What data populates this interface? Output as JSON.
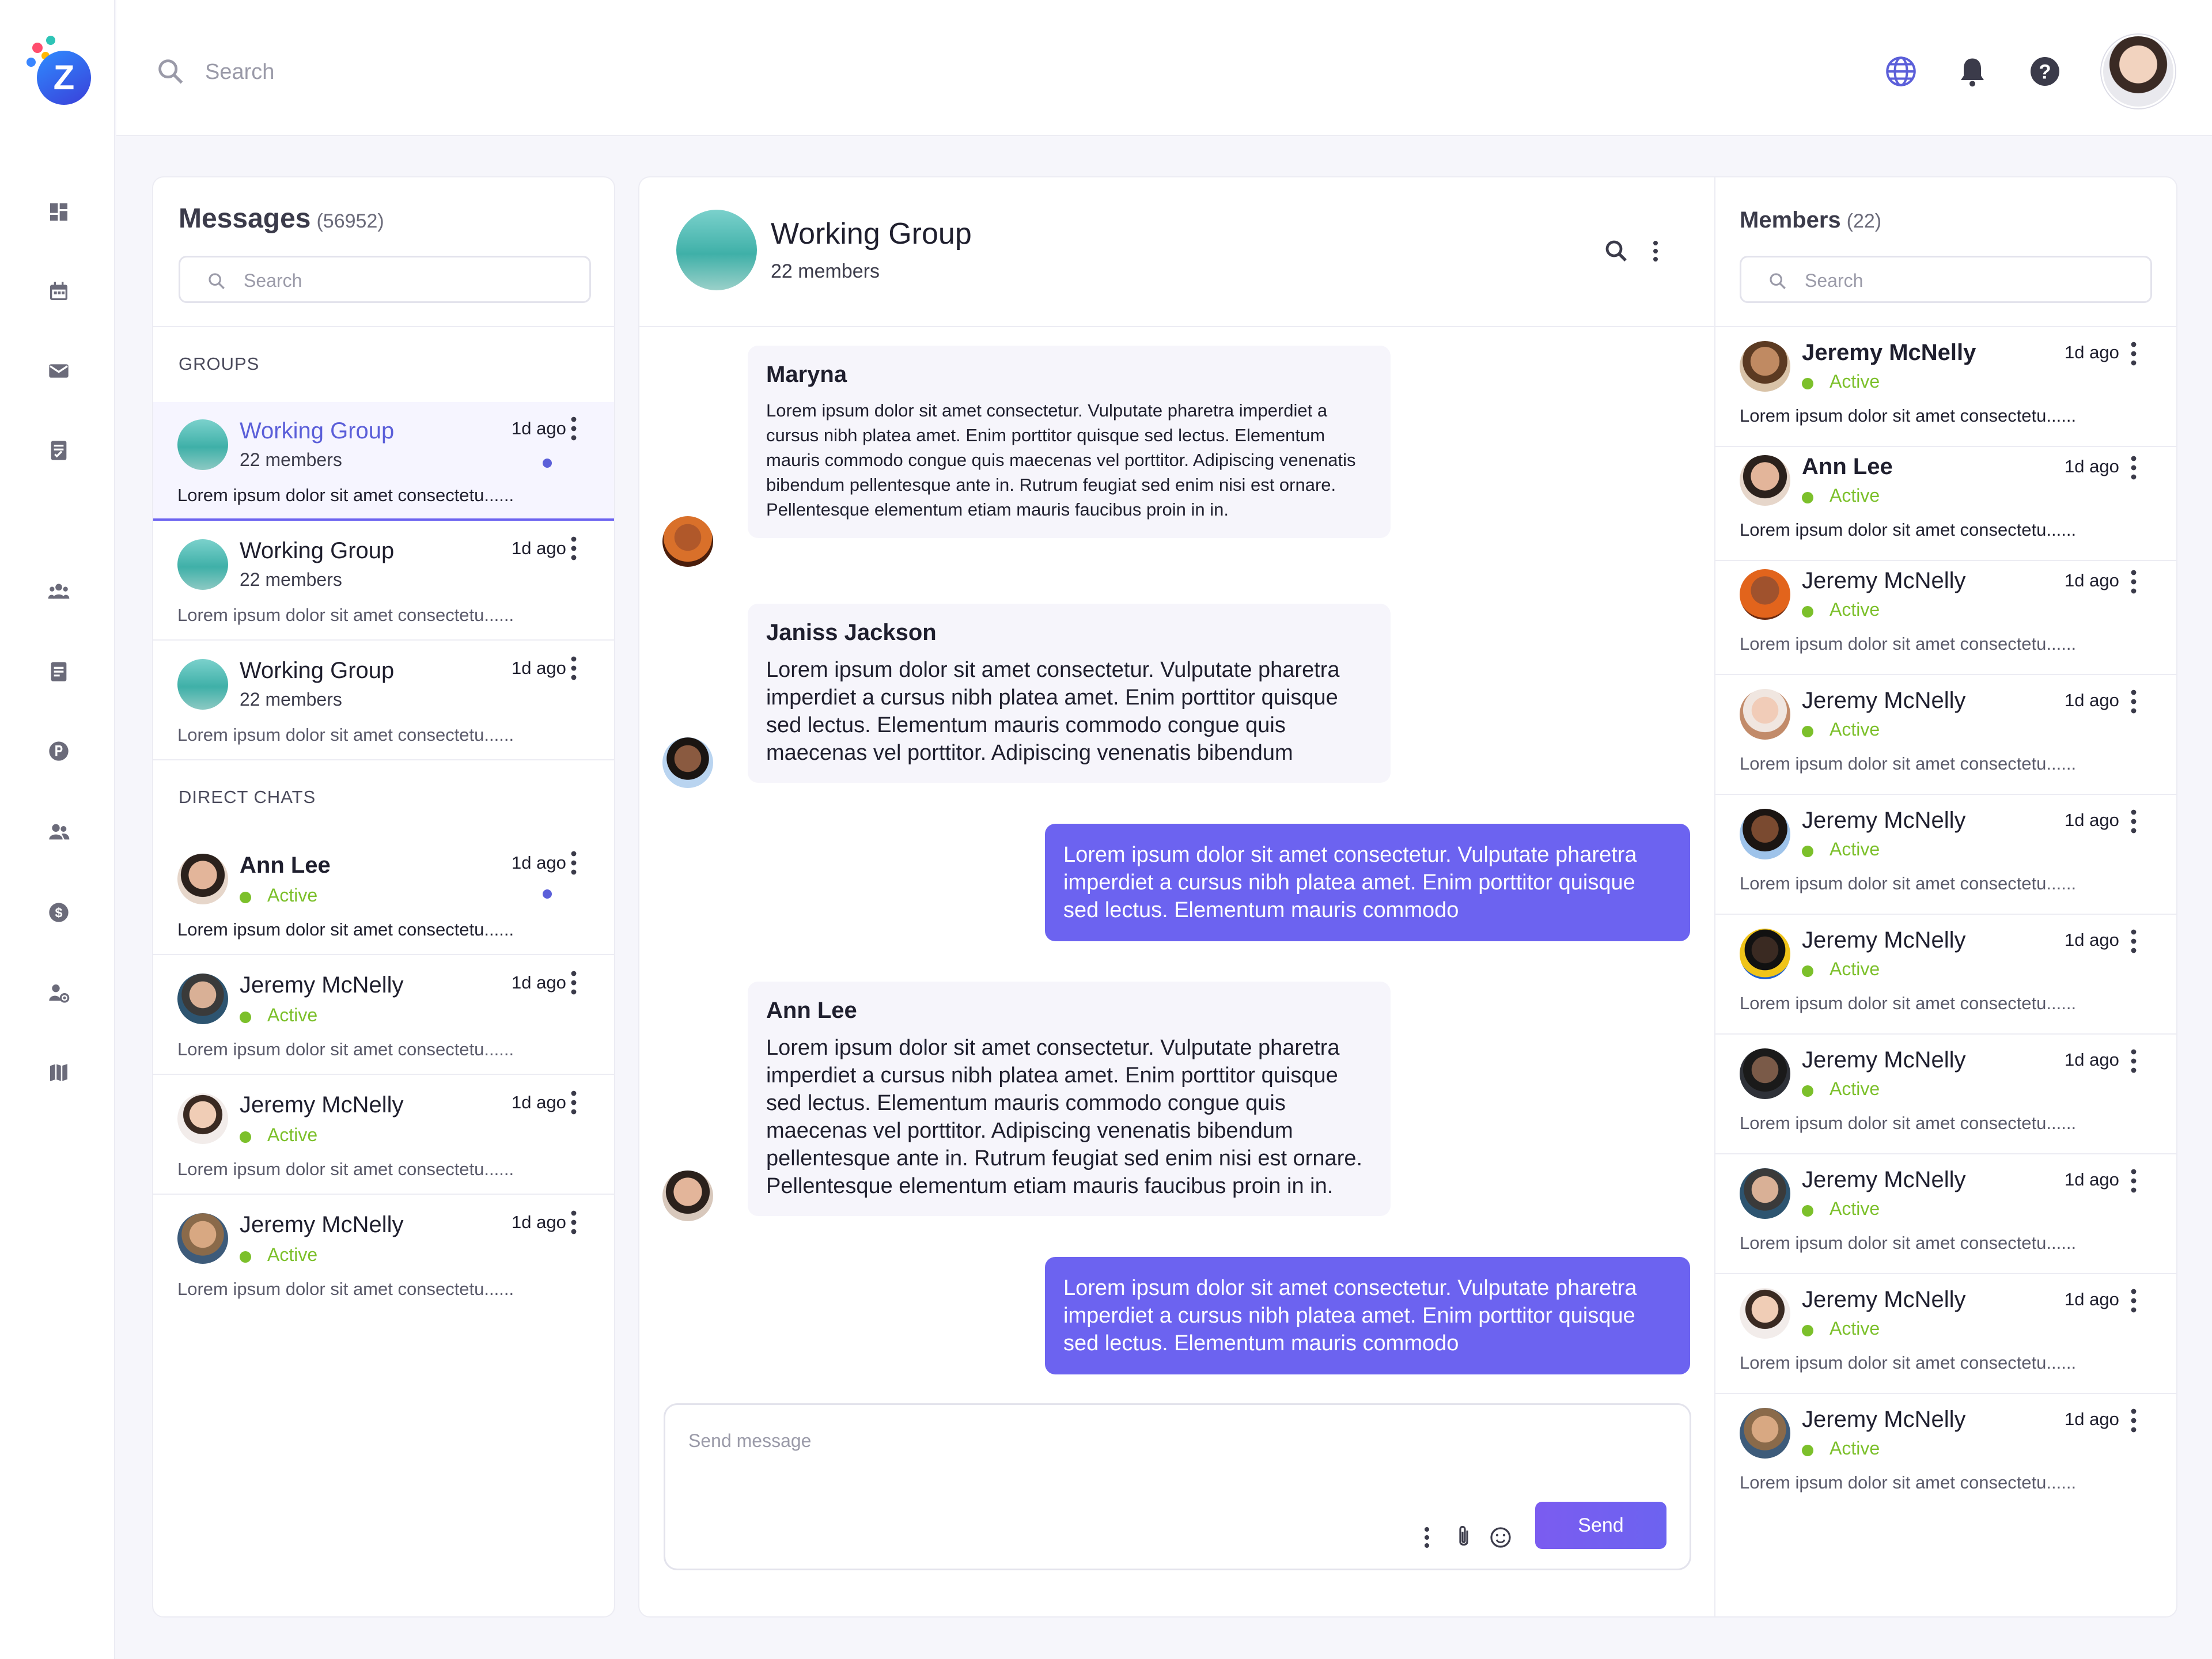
{
  "header": {
    "search_placeholder": "Search",
    "accent_color": "#6c63f0"
  },
  "icons": {
    "rail": [
      "dashboard-icon",
      "calendar-icon",
      "mail-icon",
      "report-icon",
      "team-icon",
      "document-icon",
      "parking-icon",
      "contacts-icon",
      "dollar-icon",
      "user-settings-icon",
      "map-icon"
    ],
    "top": [
      "globe-icon",
      "bell-icon",
      "help-icon"
    ]
  },
  "messages_panel": {
    "title": "Messages",
    "count": "(56952)",
    "search_placeholder": "Search",
    "groups_label": "GROUPS",
    "direct_label": "DIRECT CHATS",
    "groups": [
      {
        "name": "Working Group",
        "sub": "22 members",
        "time": "1d ago",
        "preview": "Lorem ipsum dolor sit amet consectetu......"
      },
      {
        "name": "Working Group",
        "sub": "22 members",
        "time": "1d ago",
        "preview": "Lorem ipsum dolor sit amet consectetu......"
      },
      {
        "name": "Working Group",
        "sub": "22 members",
        "time": "1d ago",
        "preview": "Lorem ipsum dolor sit amet consectetu......"
      }
    ],
    "direct": [
      {
        "name": "Ann Lee",
        "status": "Active",
        "time": "1d ago",
        "preview": "Lorem ipsum dolor sit amet consectetu......"
      },
      {
        "name": "Jeremy McNelly",
        "status": "Active",
        "time": "1d ago",
        "preview": "Lorem ipsum dolor sit amet consectetu......"
      },
      {
        "name": "Jeremy McNelly",
        "status": "Active",
        "time": "1d ago",
        "preview": "Lorem ipsum dolor sit amet consectetu......"
      },
      {
        "name": "Jeremy McNelly",
        "status": "Active",
        "time": "1d ago",
        "preview": "Lorem ipsum dolor sit amet consectetu......"
      }
    ]
  },
  "chat": {
    "title": "Working Group",
    "sub": "22 members",
    "messages": [
      {
        "sender": "Maryna",
        "text": "Lorem ipsum dolor sit amet consectetur. Vulputate pharetra imperdiet a cursus nibh platea amet. Enim porttitor quisque sed lectus. Elementum mauris commodo congue quis maecenas vel porttitor. Adipiscing venenatis bibendum pellentesque ante in. Rutrum feugiat sed enim nisi est ornare. Pellentesque elementum etiam mauris faucibus proin in in."
      },
      {
        "sender": "Janiss Jackson",
        "text": "Lorem ipsum dolor sit amet consectetur. Vulputate pharetra imperdiet a cursus nibh platea amet. Enim porttitor quisque sed lectus. Elementum mauris commodo congue quis maecenas vel porttitor. Adipiscing venenatis bibendum"
      },
      {
        "text": "Lorem ipsum dolor sit amet consectetur. Vulputate pharetra imperdiet a cursus nibh platea amet. Enim porttitor quisque sed lectus. Elementum mauris commodo"
      },
      {
        "sender": "Ann Lee",
        "text": "Lorem ipsum dolor sit amet consectetur. Vulputate pharetra imperdiet a cursus nibh platea amet. Enim porttitor quisque sed lectus. Elementum mauris commodo congue quis maecenas vel porttitor. Adipiscing venenatis bibendum pellentesque ante in. Rutrum feugiat sed enim nisi est ornare. Pellentesque elementum etiam mauris faucibus proin in in."
      },
      {
        "text": "Lorem ipsum dolor sit amet consectetur. Vulputate pharetra imperdiet a cursus nibh platea amet. Enim porttitor quisque sed lectus. Elementum mauris commodo"
      }
    ],
    "composer_placeholder": "Send message",
    "send_label": "Send"
  },
  "members_panel": {
    "title": "Members",
    "count": "(22)",
    "search_placeholder": "Search",
    "members": [
      {
        "name": "Jeremy McNelly",
        "status": "Active",
        "time": "1d ago",
        "preview": "Lorem ipsum dolor sit amet consectetu......"
      },
      {
        "name": "Ann Lee",
        "status": "Active",
        "time": "1d ago",
        "preview": "Lorem ipsum dolor sit amet consectetu......"
      },
      {
        "name": "Jeremy McNelly",
        "status": "Active",
        "time": "1d ago",
        "preview": "Lorem ipsum dolor sit amet consectetu......"
      },
      {
        "name": "Jeremy McNelly",
        "status": "Active",
        "time": "1d ago",
        "preview": "Lorem ipsum dolor sit amet consectetu......"
      },
      {
        "name": "Jeremy McNelly",
        "status": "Active",
        "time": "1d ago",
        "preview": "Lorem ipsum dolor sit amet consectetu......"
      },
      {
        "name": "Jeremy McNelly",
        "status": "Active",
        "time": "1d ago",
        "preview": "Lorem ipsum dolor sit amet consectetu......"
      },
      {
        "name": "Jeremy McNelly",
        "status": "Active",
        "time": "1d ago",
        "preview": "Lorem ipsum dolor sit amet consectetu......"
      },
      {
        "name": "Jeremy McNelly",
        "status": "Active",
        "time": "1d ago",
        "preview": "Lorem ipsum dolor sit amet consectetu......"
      },
      {
        "name": "Jeremy McNelly",
        "status": "Active",
        "time": "1d ago",
        "preview": "Lorem ipsum dolor sit amet consectetu......"
      },
      {
        "name": "Jeremy McNelly",
        "status": "Active",
        "time": "1d ago",
        "preview": "Lorem ipsum dolor sit amet consectetu......"
      }
    ]
  }
}
